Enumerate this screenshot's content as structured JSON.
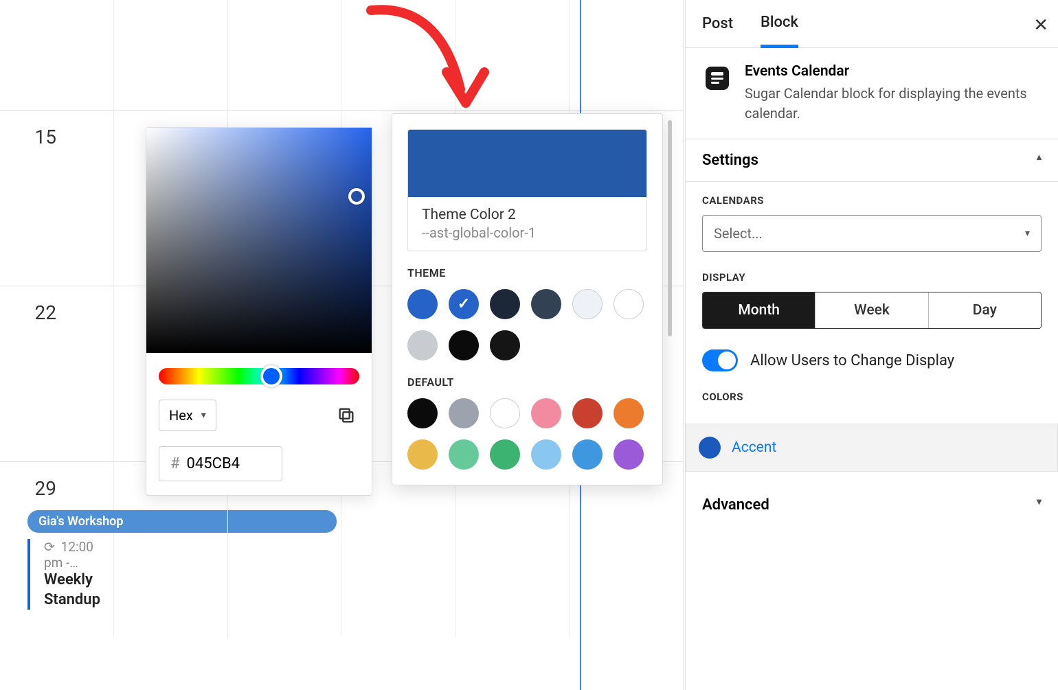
{
  "calendar": {
    "days": [
      "15",
      "22",
      "29"
    ],
    "event_pill": "Gia's Workshop",
    "event_time": "12:00 pm -…",
    "event_title_l1": "Weekly",
    "event_title_l2": "Standup"
  },
  "picker": {
    "format": "Hex",
    "hex_value": "045CB4"
  },
  "swatch_popover": {
    "color_name": "Theme Color 2",
    "color_var": "--ast-global-color-1",
    "theme_label": "THEME",
    "default_label": "DEFAULT",
    "theme_colors": [
      {
        "hex": "#2563c9",
        "selected": false
      },
      {
        "hex": "#2563c9",
        "selected": true
      },
      {
        "hex": "#1c2738",
        "selected": false
      },
      {
        "hex": "#334155",
        "selected": false
      },
      {
        "hex": "#eef2f7",
        "selected": false,
        "bordered": true
      },
      {
        "hex": "#ffffff",
        "selected": false,
        "bordered": true
      },
      {
        "hex": "#c8ccd1",
        "selected": false
      },
      {
        "hex": "#0b0b0b",
        "selected": false
      },
      {
        "hex": "#151515",
        "selected": false
      }
    ],
    "default_colors": [
      {
        "hex": "#0b0b0b"
      },
      {
        "hex": "#9ca3af"
      },
      {
        "hex": "#ffffff",
        "bordered": true
      },
      {
        "hex": "#f28aa0"
      },
      {
        "hex": "#c9402f"
      },
      {
        "hex": "#ed7b2e"
      },
      {
        "hex": "#e9b949"
      },
      {
        "hex": "#66c99a"
      },
      {
        "hex": "#3cb371"
      },
      {
        "hex": "#89c7f0"
      },
      {
        "hex": "#3f97e0"
      },
      {
        "hex": "#9b5bd8"
      }
    ]
  },
  "sidebar": {
    "tabs": {
      "post": "Post",
      "block": "Block"
    },
    "block_title": "Events Calendar",
    "block_desc": "Sugar Calendar block for displaying the events calendar.",
    "settings_label": "Settings",
    "calendars_label": "CALENDARS",
    "select_placeholder": "Select...",
    "display_label": "DISPLAY",
    "display_options": {
      "month": "Month",
      "week": "Week",
      "day": "Day"
    },
    "toggle_label": "Allow Users to Change Display",
    "colors_label": "COLORS",
    "accent_label": "Accent",
    "advanced_label": "Advanced"
  }
}
